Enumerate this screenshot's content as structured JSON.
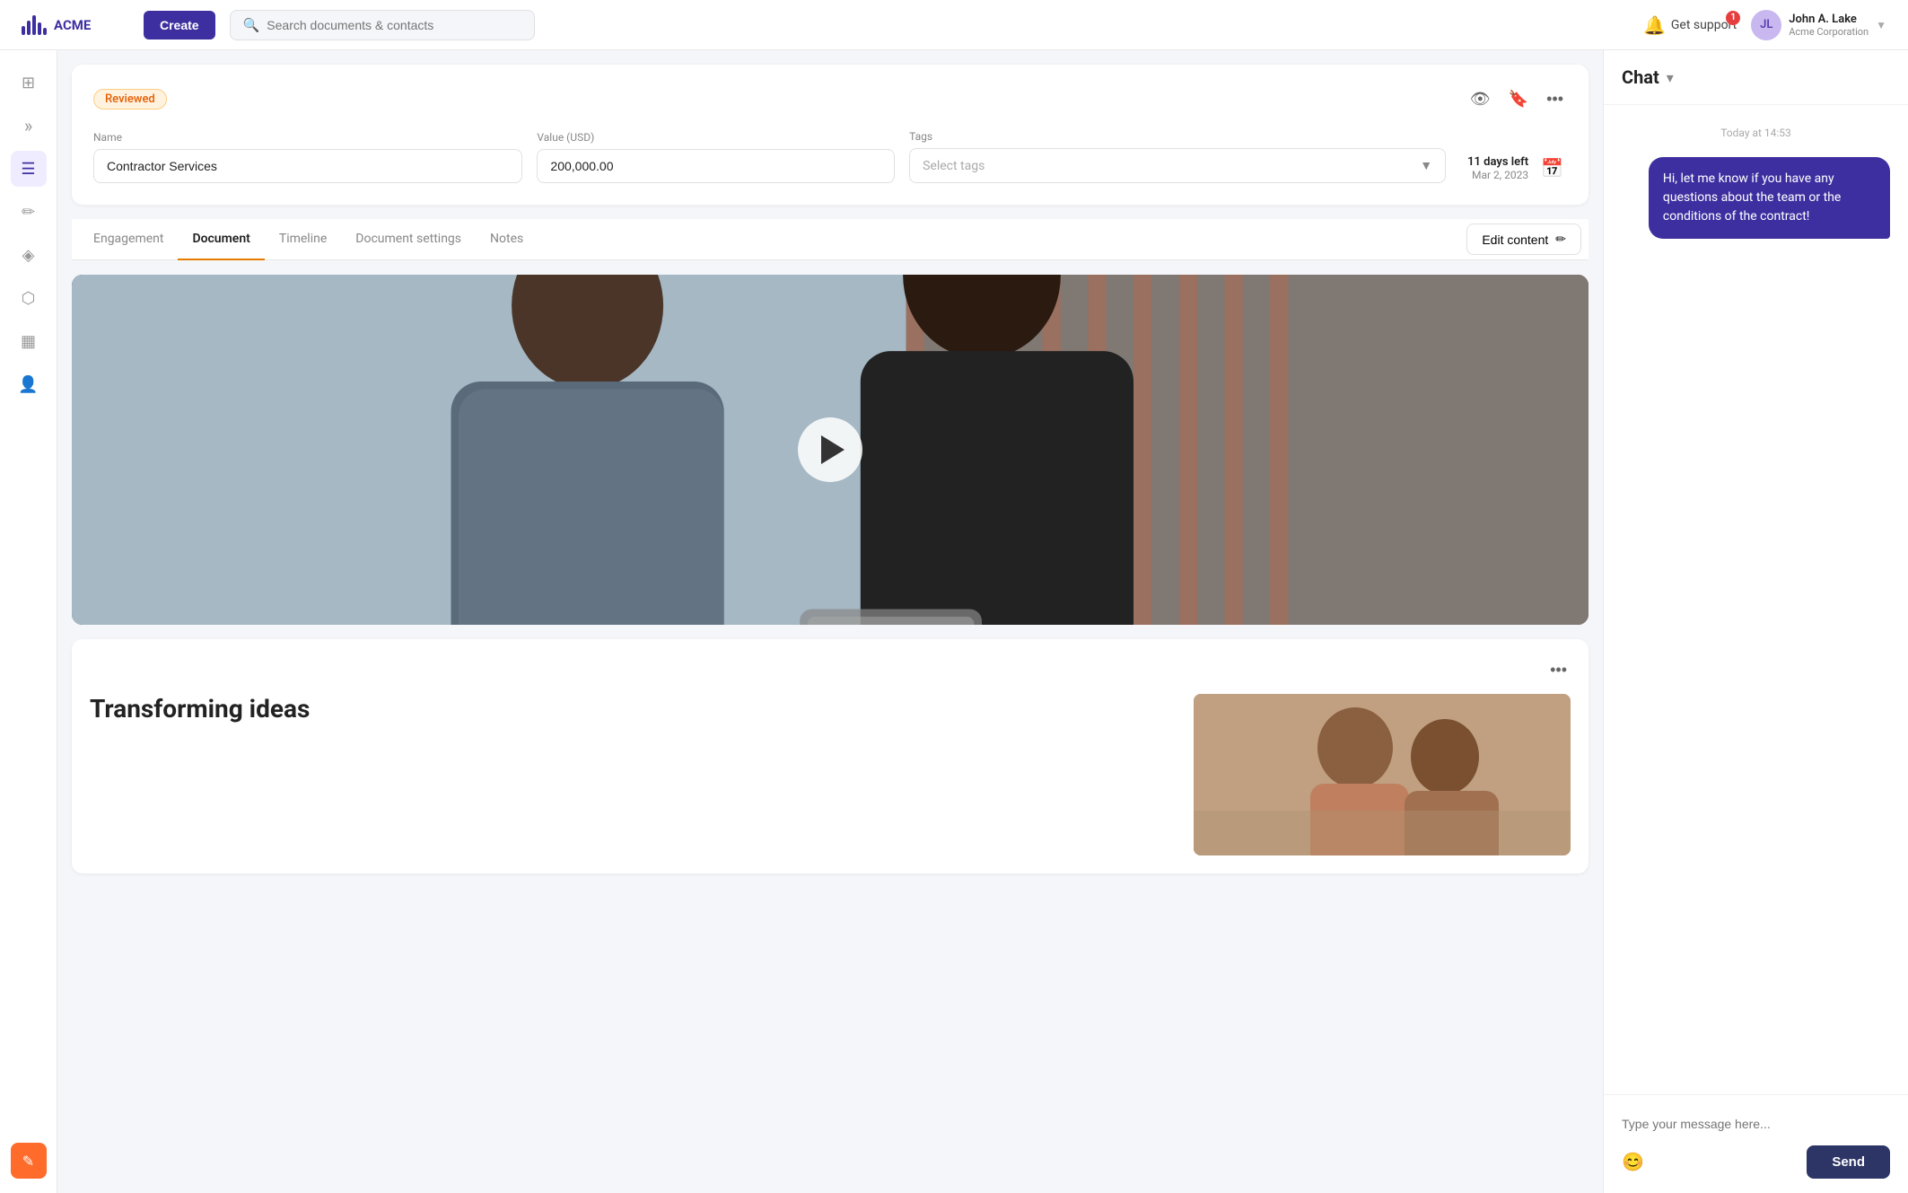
{
  "topbar": {
    "logo_text": "ACME",
    "create_label": "Create",
    "search_placeholder": "Search documents & contacts",
    "support_label": "Get support",
    "notification_count": "1",
    "user": {
      "name": "John A. Lake",
      "org": "Acme Corporation"
    }
  },
  "sidebar": {
    "items": [
      {
        "id": "grid",
        "icon": "⊞",
        "active": false
      },
      {
        "id": "chevron-right",
        "icon": "»",
        "active": false
      },
      {
        "id": "document",
        "icon": "☰",
        "active": true
      },
      {
        "id": "edit",
        "icon": "✏",
        "active": false
      },
      {
        "id": "cube",
        "icon": "◈",
        "active": false
      },
      {
        "id": "layers",
        "icon": "⬡",
        "active": false
      },
      {
        "id": "chart",
        "icon": "▦",
        "active": false
      },
      {
        "id": "contacts",
        "icon": "👤",
        "active": false
      }
    ],
    "bottom_icon": "✎"
  },
  "document": {
    "badge": "Reviewed",
    "name_label": "Name",
    "name_value": "Contractor Services",
    "value_label": "Value (USD)",
    "value_value": "200,000.00",
    "tags_label": "Tags",
    "tags_placeholder": "Select tags",
    "deadline_days": "11 days left",
    "deadline_date": "Mar 2, 2023"
  },
  "tabs": {
    "items": [
      {
        "id": "engagement",
        "label": "Engagement",
        "active": false
      },
      {
        "id": "document",
        "label": "Document",
        "active": true
      },
      {
        "id": "timeline",
        "label": "Timeline",
        "active": false
      },
      {
        "id": "document-settings",
        "label": "Document settings",
        "active": false
      },
      {
        "id": "notes",
        "label": "Notes",
        "active": false
      }
    ],
    "edit_content_label": "Edit content"
  },
  "chat": {
    "title": "Chat",
    "timestamp": "Today at 14:53",
    "message": "Hi, let me know if you have any questions about the team or the conditions of the contract!",
    "input_placeholder": "Type your message here...",
    "send_label": "Send"
  },
  "second_section": {
    "title": "Transforming ideas"
  }
}
